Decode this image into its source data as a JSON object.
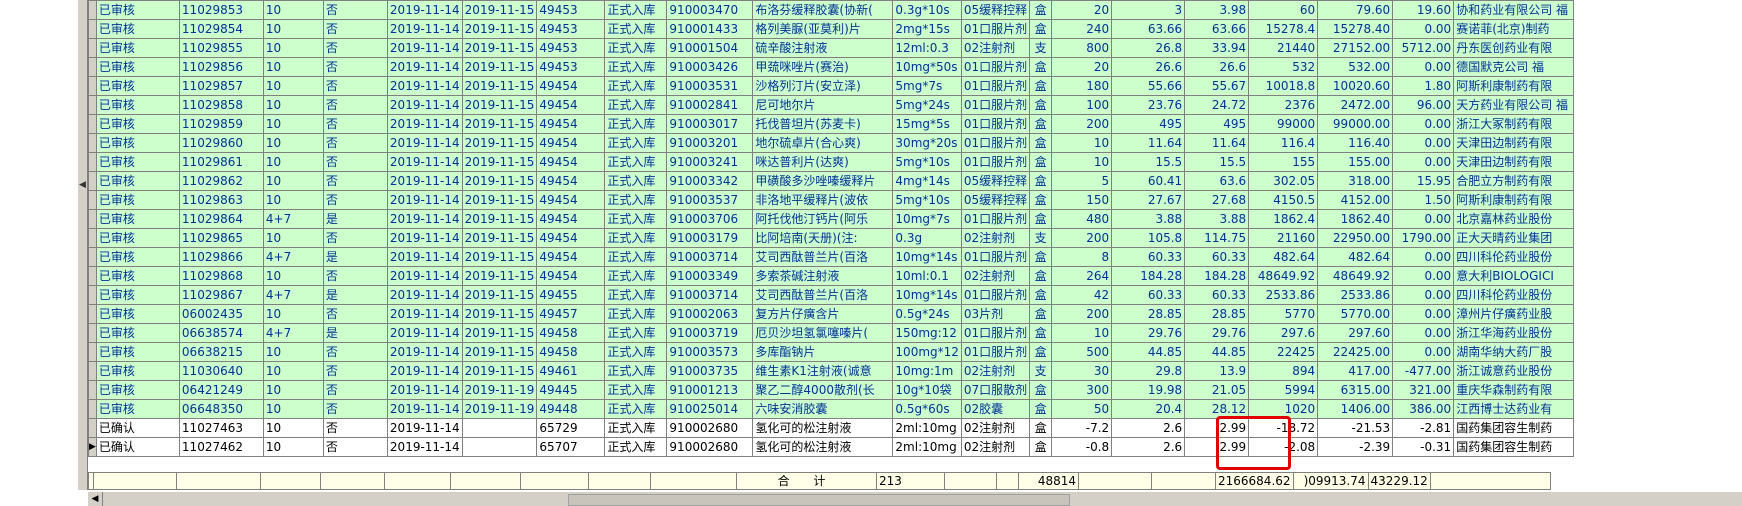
{
  "grid": {
    "rows": [
      {
        "status": "已审核",
        "no": "11029853",
        "grp": "10",
        "yn": "否",
        "d1": "2019-11-14",
        "d2": "2019-11-15",
        "bill": "49453",
        "type": "正式入库",
        "code": "910003470",
        "name": "布洛芬缓释胶囊(协新(",
        "spec": "0.3g*10s",
        "form": "05缓释控释",
        "unit": "盒",
        "qty": "20",
        "p1": "3",
        "p2": "3.98",
        "a1": "60",
        "a2": "79.60",
        "diff": "19.60",
        "mfr": "协和药业有限公司 福"
      },
      {
        "status": "已审核",
        "no": "11029854",
        "grp": "10",
        "yn": "否",
        "d1": "2019-11-14",
        "d2": "2019-11-15",
        "bill": "49453",
        "type": "正式入库",
        "code": "910001433",
        "name": "格列美脲(亚莫利)片",
        "spec": "2mg*15s",
        "form": "01口服片剂",
        "unit": "盒",
        "qty": "240",
        "p1": "63.66",
        "p2": "63.66",
        "a1": "15278.4",
        "a2": "15278.40",
        "diff": "0.00",
        "mfr": "赛诺菲(北京)制药"
      },
      {
        "status": "已审核",
        "no": "11029855",
        "grp": "10",
        "yn": "否",
        "d1": "2019-11-14",
        "d2": "2019-11-15",
        "bill": "49453",
        "type": "正式入库",
        "code": "910001504",
        "name": "硫辛酸注射液",
        "spec": "12ml:0.3",
        "form": "02注射剂",
        "unit": "支",
        "qty": "800",
        "p1": "26.8",
        "p2": "33.94",
        "a1": "21440",
        "a2": "27152.00",
        "diff": "5712.00",
        "mfr": "丹东医创药业有限"
      },
      {
        "status": "已审核",
        "no": "11029856",
        "grp": "10",
        "yn": "否",
        "d1": "2019-11-14",
        "d2": "2019-11-15",
        "bill": "49453",
        "type": "正式入库",
        "code": "910003426",
        "name": "甲巯咪唑片(赛治)",
        "spec": "10mg*50s",
        "form": "01口服片剂",
        "unit": "盒",
        "qty": "20",
        "p1": "26.6",
        "p2": "26.6",
        "a1": "532",
        "a2": "532.00",
        "diff": "0.00",
        "mfr": "德国默克公司 福"
      },
      {
        "status": "已审核",
        "no": "11029857",
        "grp": "10",
        "yn": "否",
        "d1": "2019-11-14",
        "d2": "2019-11-15",
        "bill": "49454",
        "type": "正式入库",
        "code": "910003531",
        "name": "沙格列汀片(安立泽)",
        "spec": "5mg*7s",
        "form": "01口服片剂",
        "unit": "盒",
        "qty": "180",
        "p1": "55.66",
        "p2": "55.67",
        "a1": "10018.8",
        "a2": "10020.60",
        "diff": "1.80",
        "mfr": "阿斯利康制药有限"
      },
      {
        "status": "已审核",
        "no": "11029858",
        "grp": "10",
        "yn": "否",
        "d1": "2019-11-14",
        "d2": "2019-11-15",
        "bill": "49454",
        "type": "正式入库",
        "code": "910002841",
        "name": "尼可地尔片",
        "spec": "5mg*24s",
        "form": "01口服片剂",
        "unit": "盒",
        "qty": "100",
        "p1": "23.76",
        "p2": "24.72",
        "a1": "2376",
        "a2": "2472.00",
        "diff": "96.00",
        "mfr": "天方药业有限公司 福"
      },
      {
        "status": "已审核",
        "no": "11029859",
        "grp": "10",
        "yn": "否",
        "d1": "2019-11-14",
        "d2": "2019-11-15",
        "bill": "49454",
        "type": "正式入库",
        "code": "910003017",
        "name": "托伐普坦片(苏麦卡)",
        "spec": "15mg*5s",
        "form": "01口服片剂",
        "unit": "盒",
        "qty": "200",
        "p1": "495",
        "p2": "495",
        "a1": "99000",
        "a2": "99000.00",
        "diff": "0.00",
        "mfr": "浙江大冢制药有限"
      },
      {
        "status": "已审核",
        "no": "11029860",
        "grp": "10",
        "yn": "否",
        "d1": "2019-11-14",
        "d2": "2019-11-15",
        "bill": "49454",
        "type": "正式入库",
        "code": "910003201",
        "name": "地尔硫卓片(合心爽)",
        "spec": "30mg*20s",
        "form": "01口服片剂",
        "unit": "盒",
        "qty": "10",
        "p1": "11.64",
        "p2": "11.64",
        "a1": "116.4",
        "a2": "116.40",
        "diff": "0.00",
        "mfr": "天津田边制药有限"
      },
      {
        "status": "已审核",
        "no": "11029861",
        "grp": "10",
        "yn": "否",
        "d1": "2019-11-14",
        "d2": "2019-11-15",
        "bill": "49454",
        "type": "正式入库",
        "code": "910003241",
        "name": "咪达普利片(达爽)",
        "spec": "5mg*10s",
        "form": "01口服片剂",
        "unit": "盒",
        "qty": "10",
        "p1": "15.5",
        "p2": "15.5",
        "a1": "155",
        "a2": "155.00",
        "diff": "0.00",
        "mfr": "天津田边制药有限"
      },
      {
        "status": "已审核",
        "no": "11029862",
        "grp": "10",
        "yn": "否",
        "d1": "2019-11-14",
        "d2": "2019-11-15",
        "bill": "49454",
        "type": "正式入库",
        "code": "910003342",
        "name": "甲磺酸多沙唑嗪缓释片",
        "spec": "4mg*14s",
        "form": "05缓释控释",
        "unit": "盒",
        "qty": "5",
        "p1": "60.41",
        "p2": "63.6",
        "a1": "302.05",
        "a2": "318.00",
        "diff": "15.95",
        "mfr": "合肥立方制药有限"
      },
      {
        "status": "已审核",
        "no": "11029863",
        "grp": "10",
        "yn": "否",
        "d1": "2019-11-14",
        "d2": "2019-11-15",
        "bill": "49454",
        "type": "正式入库",
        "code": "910003537",
        "name": "非洛地平缓释片(波依",
        "spec": "5mg*10s",
        "form": "05缓释控释",
        "unit": "盒",
        "qty": "150",
        "p1": "27.67",
        "p2": "27.68",
        "a1": "4150.5",
        "a2": "4152.00",
        "diff": "1.50",
        "mfr": "阿斯利康制药有限"
      },
      {
        "status": "已审核",
        "no": "11029864",
        "grp": "4+7",
        "yn": "是",
        "d1": "2019-11-14",
        "d2": "2019-11-15",
        "bill": "49454",
        "type": "正式入库",
        "code": "910003706",
        "name": "阿托伐他汀钙片(阿乐",
        "spec": "10mg*7s",
        "form": "01口服片剂",
        "unit": "盒",
        "qty": "480",
        "p1": "3.88",
        "p2": "3.88",
        "a1": "1862.4",
        "a2": "1862.40",
        "diff": "0.00",
        "mfr": "北京嘉林药业股份"
      },
      {
        "status": "已审核",
        "no": "11029865",
        "grp": "10",
        "yn": "否",
        "d1": "2019-11-14",
        "d2": "2019-11-15",
        "bill": "49454",
        "type": "正式入库",
        "code": "910003179",
        "name": "比阿培南(天册)(注:",
        "spec": "0.3g",
        "form": "02注射剂",
        "unit": "支",
        "qty": "200",
        "p1": "105.8",
        "p2": "114.75",
        "a1": "21160",
        "a2": "22950.00",
        "diff": "1790.00",
        "mfr": "正大天晴药业集团"
      },
      {
        "status": "已审核",
        "no": "11029866",
        "grp": "4+7",
        "yn": "是",
        "d1": "2019-11-14",
        "d2": "2019-11-15",
        "bill": "49454",
        "type": "正式入库",
        "code": "910003714",
        "name": "艾司西酞普兰片(百洛",
        "spec": "10mg*14s",
        "form": "01口服片剂",
        "unit": "盒",
        "qty": "8",
        "p1": "60.33",
        "p2": "60.33",
        "a1": "482.64",
        "a2": "482.64",
        "diff": "0.00",
        "mfr": "四川科伦药业股份"
      },
      {
        "status": "已审核",
        "no": "11029868",
        "grp": "10",
        "yn": "否",
        "d1": "2019-11-14",
        "d2": "2019-11-15",
        "bill": "49454",
        "type": "正式入库",
        "code": "910003349",
        "name": "多索茶碱注射液",
        "spec": "10ml:0.1",
        "form": "02注射剂",
        "unit": "盒",
        "qty": "264",
        "p1": "184.28",
        "p2": "184.28",
        "a1": "48649.92",
        "a2": "48649.92",
        "diff": "0.00",
        "mfr": "意大利BIOLOGICI"
      },
      {
        "status": "已审核",
        "no": "11029867",
        "grp": "4+7",
        "yn": "是",
        "d1": "2019-11-14",
        "d2": "2019-11-15",
        "bill": "49455",
        "type": "正式入库",
        "code": "910003714",
        "name": "艾司西酞普兰片(百洛",
        "spec": "10mg*14s",
        "form": "01口服片剂",
        "unit": "盒",
        "qty": "42",
        "p1": "60.33",
        "p2": "60.33",
        "a1": "2533.86",
        "a2": "2533.86",
        "diff": "0.00",
        "mfr": "四川科伦药业股份"
      },
      {
        "status": "已审核",
        "no": "06002435",
        "grp": "10",
        "yn": "否",
        "d1": "2019-11-14",
        "d2": "2019-11-15",
        "bill": "49457",
        "type": "正式入库",
        "code": "910002063",
        "name": "复方片仔癀含片",
        "spec": "0.5g*24s",
        "form": "03片剂",
        "unit": "盒",
        "qty": "200",
        "p1": "28.85",
        "p2": "28.85",
        "a1": "5770",
        "a2": "5770.00",
        "diff": "0.00",
        "mfr": "漳州片仔癀药业股"
      },
      {
        "status": "已审核",
        "no": "06638574",
        "grp": "4+7",
        "yn": "是",
        "d1": "2019-11-14",
        "d2": "2019-11-15",
        "bill": "49458",
        "type": "正式入库",
        "code": "910003719",
        "name": "厄贝沙坦氢氯噻嗪片(",
        "spec": "150mg:12",
        "form": "01口服片剂",
        "unit": "盒",
        "qty": "10",
        "p1": "29.76",
        "p2": "29.76",
        "a1": "297.6",
        "a2": "297.60",
        "diff": "0.00",
        "mfr": "浙江华海药业股份"
      },
      {
        "status": "已审核",
        "no": "06638215",
        "grp": "10",
        "yn": "否",
        "d1": "2019-11-14",
        "d2": "2019-11-15",
        "bill": "49458",
        "type": "正式入库",
        "code": "910003573",
        "name": "多库酯钠片",
        "spec": "100mg*12",
        "form": "01口服片剂",
        "unit": "盒",
        "qty": "500",
        "p1": "44.85",
        "p2": "44.85",
        "a1": "22425",
        "a2": "22425.00",
        "diff": "0.00",
        "mfr": "湖南华纳大药厂股"
      },
      {
        "status": "已审核",
        "no": "11030640",
        "grp": "10",
        "yn": "否",
        "d1": "2019-11-14",
        "d2": "2019-11-15",
        "bill": "49461",
        "type": "正式入库",
        "code": "910003735",
        "name": "维生素K1注射液(诚意",
        "spec": "10mg:1m",
        "form": "02注射剂",
        "unit": "支",
        "qty": "30",
        "p1": "29.8",
        "p2": "13.9",
        "a1": "894",
        "a2": "417.00",
        "diff": "-477.00",
        "mfr": "浙江诚意药业股份"
      },
      {
        "status": "已审核",
        "no": "06421249",
        "grp": "10",
        "yn": "否",
        "d1": "2019-11-14",
        "d2": "2019-11-19",
        "bill": "49445",
        "type": "正式入库",
        "code": "910001213",
        "name": "聚乙二醇4000散剂(长",
        "spec": "10g*10袋",
        "form": "07口服散剂",
        "unit": "盒",
        "qty": "300",
        "p1": "19.98",
        "p2": "21.05",
        "a1": "5994",
        "a2": "6315.00",
        "diff": "321.00",
        "mfr": "重庆华森制药有限"
      },
      {
        "status": "已审核",
        "no": "06648350",
        "grp": "10",
        "yn": "否",
        "d1": "2019-11-14",
        "d2": "2019-11-19",
        "bill": "49448",
        "type": "正式入库",
        "code": "910025014",
        "name": "六味安消胶囊",
        "spec": "0.5g*60s",
        "form": "02胶囊",
        "unit": "盒",
        "qty": "50",
        "p1": "20.4",
        "p2": "28.12",
        "a1": "1020",
        "a2": "1406.00",
        "diff": "386.00",
        "mfr": "江西博士达药业有"
      },
      {
        "status": "已确认",
        "no": "11027463",
        "grp": "10",
        "yn": "否",
        "d1": "2019-11-14",
        "d2": "",
        "bill": "65729",
        "type": "正式入库",
        "code": "910002680",
        "name": "氢化可的松注射液",
        "spec": "2ml:10mg",
        "form": "02注射剂",
        "unit": "盒",
        "qty": "-7.2",
        "p1": "2.6",
        "p2": "2.99",
        "a1": "-18.72",
        "a2": "-21.53",
        "diff": "-2.81",
        "mfr": "国药集团容生制药"
      },
      {
        "status": "已确认",
        "no": "11027462",
        "grp": "10",
        "yn": "否",
        "d1": "2019-11-14",
        "d2": "",
        "bill": "65707",
        "type": "正式入库",
        "code": "910002680",
        "name": "氢化可的松注射液",
        "spec": "2ml:10mg",
        "form": "02注射剂",
        "unit": "盒",
        "qty": "-0.8",
        "p1": "2.6",
        "p2": "2.99",
        "a1": "-2.08",
        "a2": "-2.39",
        "diff": "-0.31",
        "mfr": "国药集团容生制药"
      }
    ]
  },
  "summary": {
    "label": "合 计",
    "count": "213",
    "qty_total": "48814",
    "amount_total": "2166684.62",
    "retail_total": ")09913.74",
    "diff_total": "43229.12"
  },
  "current_row_marker": "▶"
}
